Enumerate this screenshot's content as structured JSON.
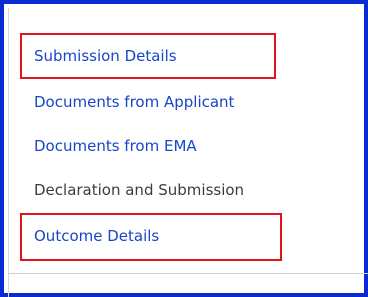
{
  "nav": {
    "items": [
      {
        "label": "Submission Details",
        "link": true,
        "highlighted": true
      },
      {
        "label": "Documents from Applicant",
        "link": true,
        "highlighted": false
      },
      {
        "label": "Documents from EMA",
        "link": true,
        "highlighted": false
      },
      {
        "label": "Declaration and Submission",
        "link": false,
        "highlighted": false
      },
      {
        "label": "Outcome Details",
        "link": true,
        "highlighted": true
      }
    ]
  },
  "colors": {
    "frame_border": "#0a2ad6",
    "link_text": "#1747c8",
    "plain_text": "#3c3c3c",
    "highlight_box": "#e0131b"
  }
}
